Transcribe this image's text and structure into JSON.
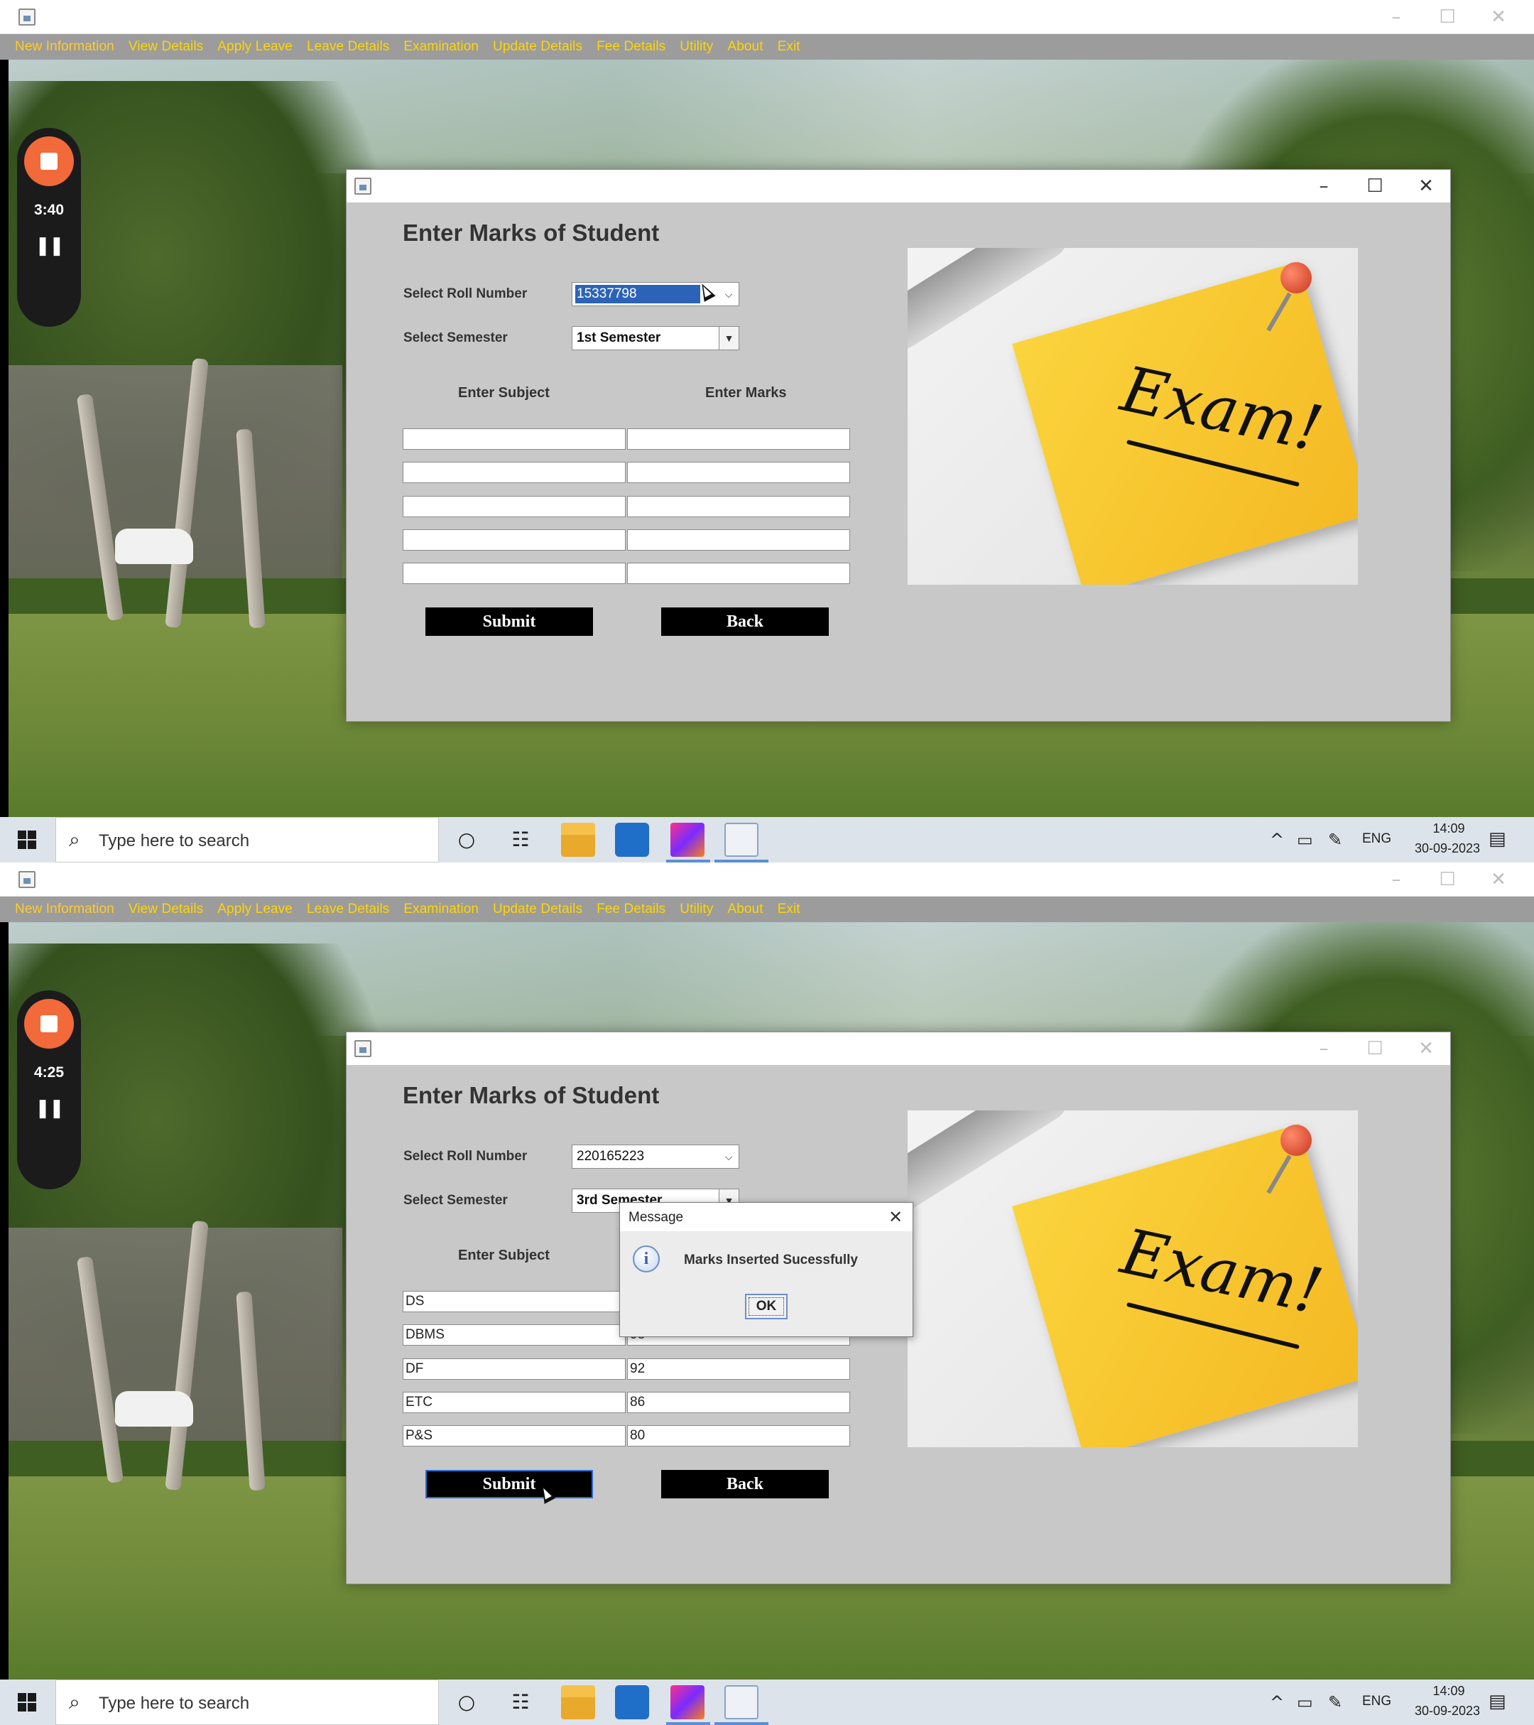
{
  "menu": [
    "New Information",
    "View Details",
    "Apply Leave",
    "Leave Details",
    "Examination",
    "Update Details",
    "Fee Details",
    "Utility",
    "About",
    "Exit"
  ],
  "form": {
    "title": "Enter Marks of Student",
    "roll_label": "Select Roll Number",
    "semester_label": "Select Semester",
    "subject_header": "Enter Subject",
    "marks_header": "Enter Marks",
    "submit": "Submit",
    "back": "Back"
  },
  "image_text": "Exam!",
  "frames": [
    {
      "recorder_time": "3:40",
      "roll_number": "15337798",
      "semester": "1st Semester",
      "rows": [
        {
          "subject": "",
          "marks": ""
        },
        {
          "subject": "",
          "marks": ""
        },
        {
          "subject": "",
          "marks": ""
        },
        {
          "subject": "",
          "marks": ""
        },
        {
          "subject": "",
          "marks": ""
        }
      ]
    },
    {
      "recorder_time": "4:25",
      "roll_number": "220165223",
      "semester": "3rd Semester",
      "rows": [
        {
          "subject": "DS",
          "marks": ""
        },
        {
          "subject": "DBMS",
          "marks": "98"
        },
        {
          "subject": "DF",
          "marks": "92"
        },
        {
          "subject": "ETC",
          "marks": "86"
        },
        {
          "subject": "P&S",
          "marks": "80"
        }
      ],
      "message": {
        "title": "Message",
        "text": "Marks Inserted Sucessfully",
        "ok": "OK"
      }
    }
  ],
  "taskbar": {
    "search_placeholder": "Type here to search",
    "language": "ENG",
    "time": "14:09",
    "date": "30-09-2023"
  },
  "colors": {
    "menu_text": "#ffd600",
    "menu_bar": "#9c9c9c",
    "dialog_bg": "#c8c8c8",
    "button_bg": "#000000",
    "selection": "#2c63b7",
    "recorder_stop": "#f26a3a"
  }
}
